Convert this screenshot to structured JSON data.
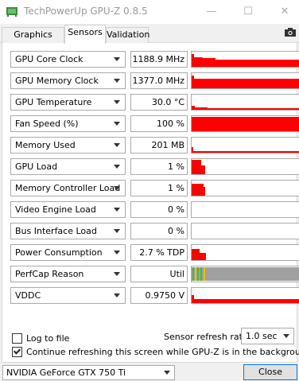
{
  "window": {
    "title": "TechPowerUp GPU-Z 0.8.5",
    "minimize_glyph": "—",
    "maximize_glyph": "☐",
    "close_glyph": "✕"
  },
  "tabs": [
    {
      "label": "Graphics Card",
      "active": false
    },
    {
      "label": "Sensors",
      "active": true
    },
    {
      "label": "Validation",
      "active": false
    }
  ],
  "icons": {
    "app": "gpu-z-app-icon",
    "screenshot": "camera-icon"
  },
  "colors": {
    "graph_fill": "#ff0000",
    "perfcap_gray": "#a0a0a0",
    "perfcap_green": "#44bb33",
    "perfcap_yellow": "#e6c000",
    "accent": "#0078d7"
  },
  "sensors": [
    {
      "label": "GPU Core Clock",
      "value": "1188.9 MHz",
      "graph": "red"
    },
    {
      "label": "GPU Memory Clock",
      "value": "1377.0 MHz",
      "graph": "red"
    },
    {
      "label": "GPU Temperature",
      "value": "30.0 °C",
      "graph": "red"
    },
    {
      "label": "Fan Speed (%)",
      "value": "100 %",
      "graph": "red"
    },
    {
      "label": "Memory Used",
      "value": "201 MB",
      "graph": "red"
    },
    {
      "label": "GPU Load",
      "value": "1 %",
      "graph": "red"
    },
    {
      "label": "Memory Controller Load",
      "value": "1 %",
      "graph": "red"
    },
    {
      "label": "Video Engine Load",
      "value": "0 %",
      "graph": "none"
    },
    {
      "label": "Bus Interface Load",
      "value": "0 %",
      "graph": "none"
    },
    {
      "label": "Power Consumption",
      "value": "2.7 % TDP",
      "graph": "red"
    },
    {
      "label": "PerfCap Reason",
      "value": "Util",
      "graph": "perfcap"
    },
    {
      "label": "VDDC",
      "value": "0.9750 V",
      "graph": "red"
    }
  ],
  "options": {
    "log_to_file": {
      "label": "Log to file",
      "checked": false
    },
    "continue_refresh": {
      "label": "Continue refreshing this screen while GPU-Z is in the background",
      "checked": true
    }
  },
  "refresh": {
    "label": "Sensor refresh rate:",
    "value": "1.0 sec"
  },
  "gpu_select": {
    "value": "NVIDIA GeForce GTX 750 Ti"
  },
  "close_button": {
    "label": "Close"
  }
}
